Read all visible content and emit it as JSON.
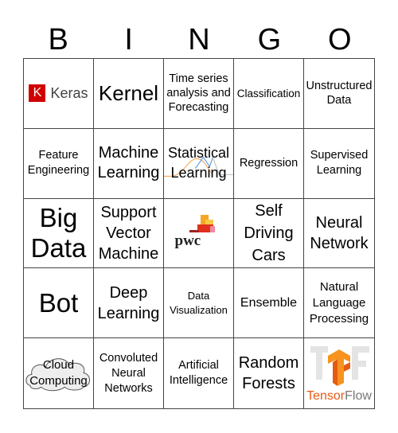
{
  "header": {
    "letters": [
      "B",
      "I",
      "N",
      "G",
      "O"
    ]
  },
  "cells": [
    {
      "logo": "keras-logo",
      "k": "K",
      "label": "Keras"
    },
    {
      "label": "Kernel"
    },
    {
      "label": "Time series analysis and Forecasting"
    },
    {
      "label": "Classification"
    },
    {
      "label": "Unstructured Data"
    },
    {
      "label": "Feature Engineering"
    },
    {
      "label": "Machine Learning"
    },
    {
      "label": "Statistical Learning"
    },
    {
      "label": "Regression"
    },
    {
      "label": "Supervised Learning"
    },
    {
      "label": "Big Data"
    },
    {
      "label": "Support Vector Machine"
    },
    {
      "logo": "pwc-logo",
      "label": "pwc"
    },
    {
      "label": "Self Driving Cars"
    },
    {
      "label": "Neural Network"
    },
    {
      "label": "Bot"
    },
    {
      "label": "Deep Learning"
    },
    {
      "label": "Data Visualization"
    },
    {
      "label": "Ensemble"
    },
    {
      "label": "Natural Language Processing"
    },
    {
      "label": "Cloud Computing"
    },
    {
      "label": "Convoluted Neural Networks"
    },
    {
      "label": "Artificial Intelligence"
    },
    {
      "label": "Random Forests"
    },
    {
      "logo": "tensorflow-logo",
      "label_a": "Tensor",
      "label_b": "Flow"
    }
  ],
  "colors": {
    "keras_red": "#d00000",
    "tf_orange": "#e55b13"
  }
}
